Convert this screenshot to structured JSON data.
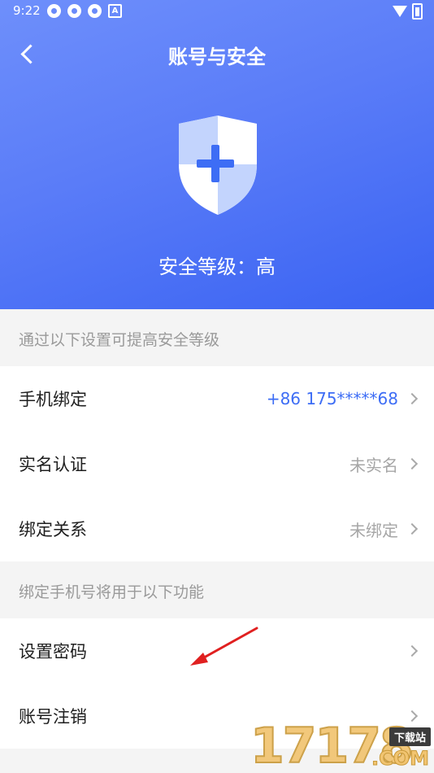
{
  "status_bar": {
    "time": "9:22",
    "notification_icons": [
      "app-icon",
      "app-icon",
      "app-icon",
      "a-icon"
    ],
    "a_icon_letter": "A",
    "right_icons": [
      "wifi-icon",
      "battery-icon"
    ]
  },
  "header": {
    "title": "账号与安全",
    "back_icon": "chevron-left-icon",
    "security_level": "安全等级：高",
    "shield_icon": "shield-plus-icon"
  },
  "sections": [
    {
      "label": "通过以下设置可提高安全等级",
      "rows": [
        {
          "label": "手机绑定",
          "value": "+86  175*****68",
          "accent": true
        },
        {
          "label": "实名认证",
          "value": "未实名",
          "accent": false
        },
        {
          "label": "绑定关系",
          "value": "未绑定",
          "accent": false
        }
      ]
    },
    {
      "label": "绑定手机号将用于以下功能",
      "rows": [
        {
          "label": "设置密码",
          "value": ""
        },
        {
          "label": "账号注销",
          "value": ""
        }
      ]
    }
  ],
  "watermark": {
    "digits": "17178",
    "badge": "下载站",
    "domain": ".COM"
  },
  "colors": {
    "header_gradient_start": "#6e8ffb",
    "header_gradient_end": "#3a63f2",
    "accent": "#3d6df5",
    "page_bg": "#f4f4f4",
    "annotation_arrow": "#e02020"
  }
}
